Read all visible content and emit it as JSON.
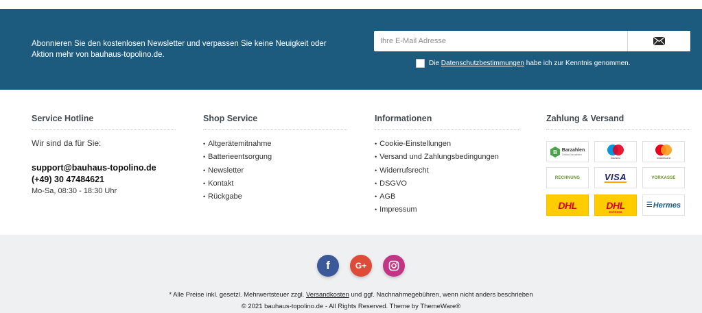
{
  "newsletter": {
    "text": "Abonnieren Sie den kostenlosen Newsletter und verpassen Sie keine Neuigkeit oder Aktion mehr von bauhaus-topolino.de.",
    "email_placeholder": "Ihre E-Mail Adresse",
    "submit_icon": "envelope-icon",
    "consent_prefix": "Die",
    "consent_link": "Datenschutzbestimmungen",
    "consent_suffix": "habe ich zur Kenntnis genommen.",
    "checked": false,
    "background_color": "#1c5b7e"
  },
  "hotline": {
    "title": "Service Hotline",
    "lead": "Wir sind da für Sie:",
    "email": "support@bauhaus-topolino.de",
    "phone": "(+49) 30 47484621",
    "hours": "Mo-Sa, 08:30 - 18:30 Uhr"
  },
  "shop_service": {
    "title": "Shop Service",
    "items": [
      "Altgerätemitnahme",
      "Batterieentsorgung",
      "Newsletter",
      "Kontakt",
      "Rückgabe"
    ]
  },
  "informationen": {
    "title": "Informationen",
    "items": [
      "Cookie-Einstellungen",
      "Versand und Zahlungsbedingungen",
      "Widerrufsrecht",
      "DSGVO",
      "AGB",
      "Impressum"
    ]
  },
  "payment": {
    "title": "Zahlung & Versand",
    "logos": {
      "barzahlen": "Barzahlen",
      "barzahlen_sub": "Online bezahlen",
      "maestro": "maestro",
      "mastercard": "mastercard",
      "rechnung": "RECHNUNG",
      "visa": "VISA",
      "vorkasse": "VORKASSE",
      "dhl": "DHL",
      "dhl_express": "DHL",
      "dhl_express_sub": "EXPRESS",
      "hermes": "Hermes"
    }
  },
  "social": {
    "facebook": "f",
    "googleplus": "G+",
    "instagram": "instagram-icon"
  },
  "legal": {
    "line1_prefix": "* Alle Preise inkl. gesetzl. Mehrwertsteuer zzgl.",
    "line1_link": "Versandkosten",
    "line1_suffix": "und ggf. Nachnahmegebühren, wenn nicht anders beschrieben",
    "line2": "© 2021 bauhaus-topolino.de - All Rights Reserved. Theme by ThemeWare®"
  }
}
